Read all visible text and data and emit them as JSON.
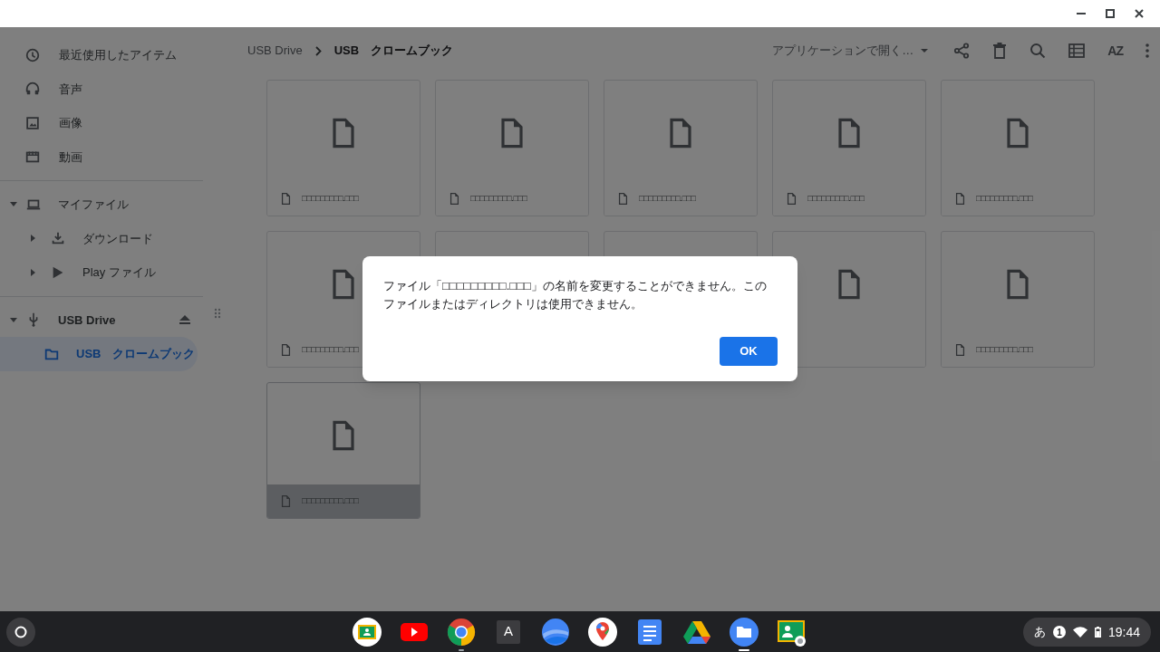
{
  "sidebar": {
    "items": [
      {
        "label": "最近使用したアイテム",
        "kind": "clock",
        "selected": false
      },
      {
        "label": "音声",
        "kind": "headphones",
        "selected": false
      },
      {
        "label": "画像",
        "kind": "image",
        "selected": false
      },
      {
        "label": "動画",
        "kind": "film",
        "selected": false
      }
    ],
    "tree": [
      {
        "label": "マイファイル",
        "kind": "laptop",
        "expanded": true,
        "selected": false,
        "children": [
          {
            "label": "ダウンロード",
            "kind": "download",
            "expanded": false,
            "selected": false
          },
          {
            "label": "Play ファイル",
            "kind": "play",
            "expanded": false,
            "selected": false
          }
        ]
      },
      {
        "label": "USB Drive",
        "kind": "usb",
        "expanded": true,
        "selected": false,
        "children": [
          {
            "label": "USB　クロームブック",
            "kind": "folder",
            "selected": true
          }
        ]
      }
    ]
  },
  "breadcrumb": [
    "USB Drive",
    "USB　クロームブック"
  ],
  "toolbar": {
    "open_with": "アプリケーションで開く…",
    "sort_label": "AZ"
  },
  "files": [
    {
      "name": "□□□□□□□□□.□□□",
      "selected": false
    },
    {
      "name": "□□□□□□□□□.□□□",
      "selected": false
    },
    {
      "name": "□□□□□□□□□.□□□",
      "selected": false
    },
    {
      "name": "□□□□□□□□□.□□□",
      "selected": false
    },
    {
      "name": "□□□□□□□□□.□□□",
      "selected": false
    },
    {
      "name": "□□□□□□□□□.□□□",
      "selected": false
    },
    {
      "selected": false
    },
    {
      "selected": false
    },
    {
      "selected": false
    },
    {
      "name": "□□□□□□□□□.□□□",
      "selected": false
    },
    {
      "name": "□□□□□□□□□.□□□",
      "selected": true
    }
  ],
  "dialog": {
    "message": "ファイル「□□□□□□□□□.□□□」の名前を変更することができません。このファイルまたはディレクトリは使用できません。",
    "button": "OK"
  },
  "shelf": {
    "apps": [
      {
        "kind": "classroom",
        "running": false,
        "active": false
      },
      {
        "kind": "youtube",
        "running": false,
        "active": false
      },
      {
        "kind": "chrome",
        "running": true,
        "active": false
      },
      {
        "kind": "letter",
        "label": "A",
        "running": false,
        "active": false
      },
      {
        "kind": "earth",
        "running": false,
        "active": false
      },
      {
        "kind": "maps",
        "running": false,
        "active": false
      },
      {
        "kind": "docs",
        "running": false,
        "active": false
      },
      {
        "kind": "drive",
        "running": false,
        "active": false
      },
      {
        "kind": "files",
        "running": true,
        "active": true
      },
      {
        "kind": "classroom-admin",
        "running": false,
        "active": false
      }
    ],
    "tray": {
      "ime": "あ",
      "notifications": "1",
      "time": "19:44"
    }
  }
}
